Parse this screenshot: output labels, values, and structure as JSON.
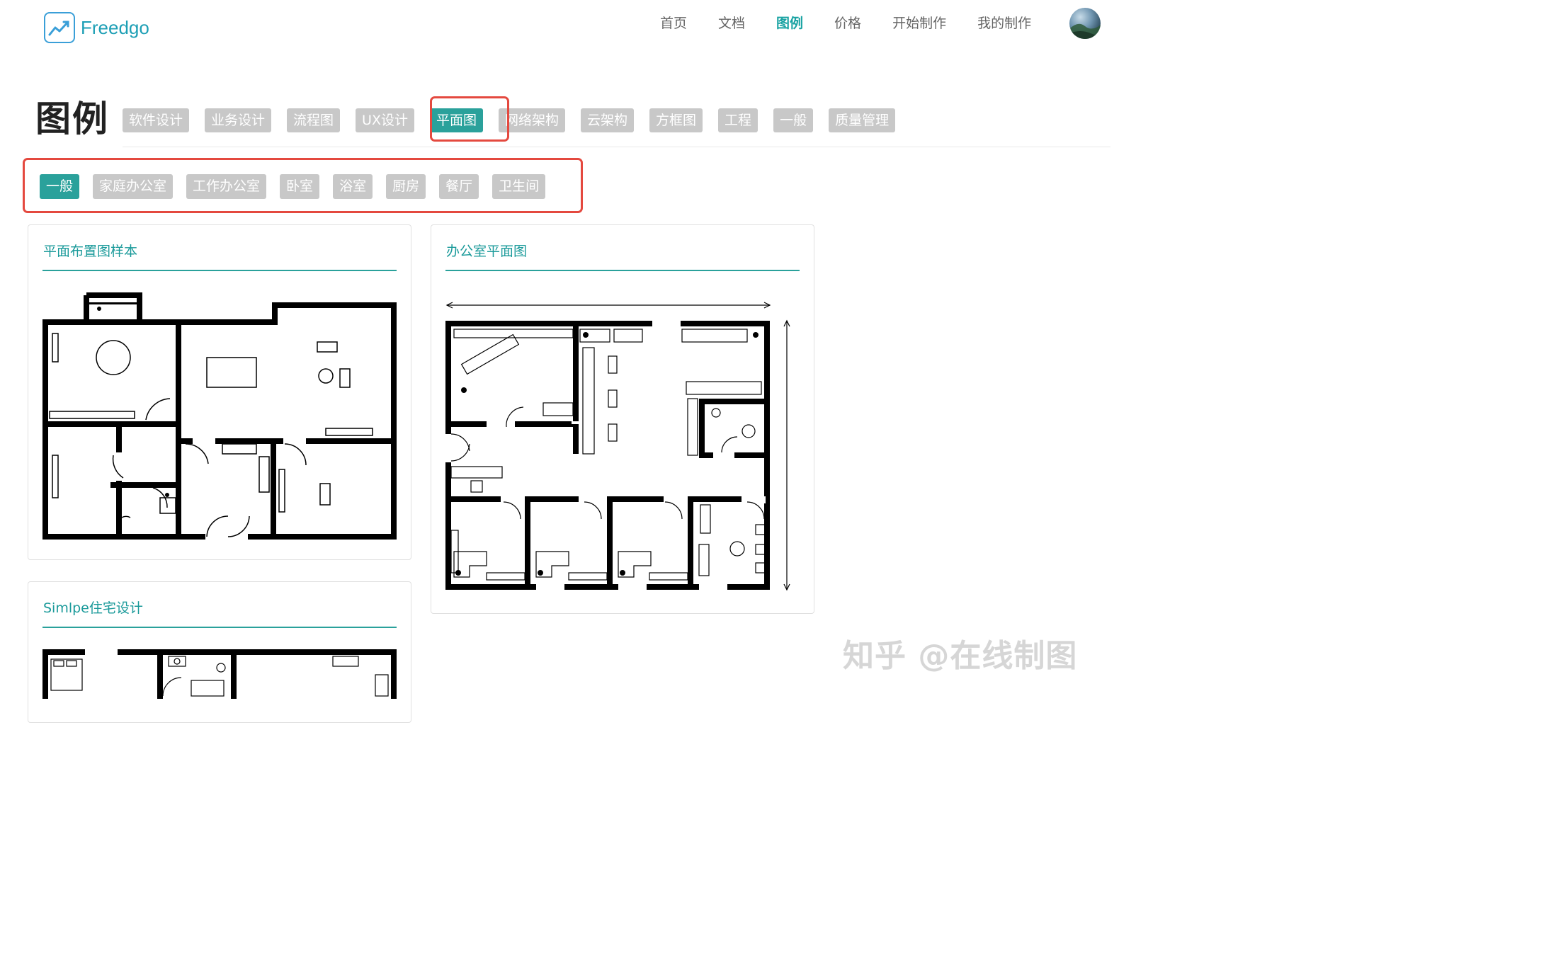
{
  "header": {
    "logo_text": "Freedgo",
    "nav": [
      {
        "label": "首页",
        "active": false
      },
      {
        "label": "文档",
        "active": false
      },
      {
        "label": "图例",
        "active": true
      },
      {
        "label": "价格",
        "active": false
      },
      {
        "label": "开始制作",
        "active": false
      },
      {
        "label": "我的制作",
        "active": false
      }
    ],
    "accent_color": "#2aa19b"
  },
  "page": {
    "title": "图例",
    "categories": [
      "软件设计",
      "业务设计",
      "流程图",
      "UX设计",
      "平面图",
      "网络架构",
      "云架构",
      "方框图",
      "工程",
      "一般",
      "质量管理"
    ],
    "selected_category": "平面图",
    "subcategories": [
      "一般",
      "家庭办公室",
      "工作办公室",
      "卧室",
      "浴室",
      "厨房",
      "餐厅",
      "卫生间"
    ],
    "selected_subcategory": "一般",
    "highlight_color": "#e4493f"
  },
  "cards": [
    {
      "title": "平面布置图样本"
    },
    {
      "title": "办公室平面图"
    },
    {
      "title": "Simlpe住宅设计"
    }
  ],
  "watermark": "知乎 @在线制图",
  "icons": {
    "logo": "trend-chart-icon",
    "avatar": "user-avatar"
  }
}
